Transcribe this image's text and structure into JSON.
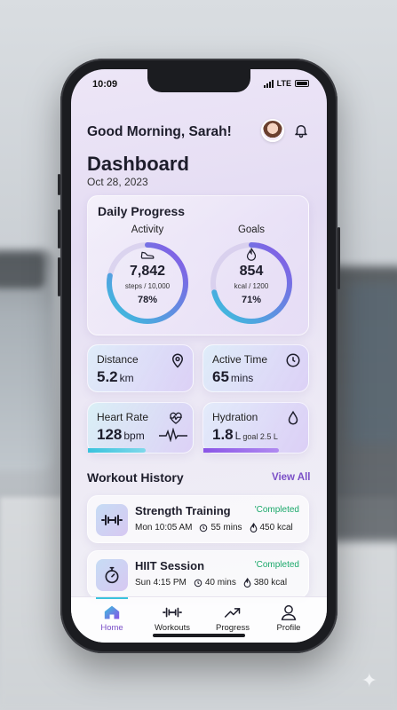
{
  "status_bar": {
    "time": "10:09",
    "network": "LTE"
  },
  "header": {
    "greeting": "Good Morning, Sarah!",
    "title": "Dashboard",
    "date": "Oct 28, 2023"
  },
  "daily_progress": {
    "title": "Daily Progress",
    "activity": {
      "label": "Activity",
      "value": "7,842",
      "detail": "steps / 10,000",
      "percent_text": "78%",
      "percent": 0.78
    },
    "goals": {
      "label": "Goals",
      "value": "854",
      "detail": "kcal / 1200",
      "percent_text": "71%",
      "percent": 0.71
    }
  },
  "stats": {
    "distance": {
      "label": "Distance",
      "value": "5.2",
      "unit": "km"
    },
    "active_time": {
      "label": "Active Time",
      "value": "65",
      "unit": "mins"
    },
    "heart_rate": {
      "label": "Heart Rate",
      "value": "128",
      "unit": "bpm",
      "progress": 0.55
    },
    "hydration": {
      "label": "Hydration",
      "value": "1.8",
      "unit": "L",
      "goal": "goal 2.5 L",
      "progress": 0.72
    }
  },
  "workout_history": {
    "title": "Workout History",
    "view_all": "View All",
    "items": [
      {
        "name": "Strength Training",
        "status": "'Completed",
        "time": "Mon 10:05 AM",
        "duration": "55 mins",
        "calories": "450 kcal",
        "icon": "dumbbell-icon"
      },
      {
        "name": "HIIT Session",
        "status": "'Completed",
        "time": "Sun 4:15 PM",
        "duration": "40 mins",
        "calories": "380 kcal",
        "icon": "stopwatch-icon"
      }
    ]
  },
  "tabs": [
    {
      "label": "Home",
      "icon": "home-icon",
      "active": true
    },
    {
      "label": "Workouts",
      "icon": "dumbbell-icon",
      "active": false
    },
    {
      "label": "Progress",
      "icon": "trend-icon",
      "active": false
    },
    {
      "label": "Profile",
      "icon": "user-icon",
      "active": false
    }
  ],
  "colors": {
    "accent": "#7a4fc7",
    "cyan": "#39c3dd",
    "purple": "#8a55e6",
    "completed": "#1aa86a"
  }
}
